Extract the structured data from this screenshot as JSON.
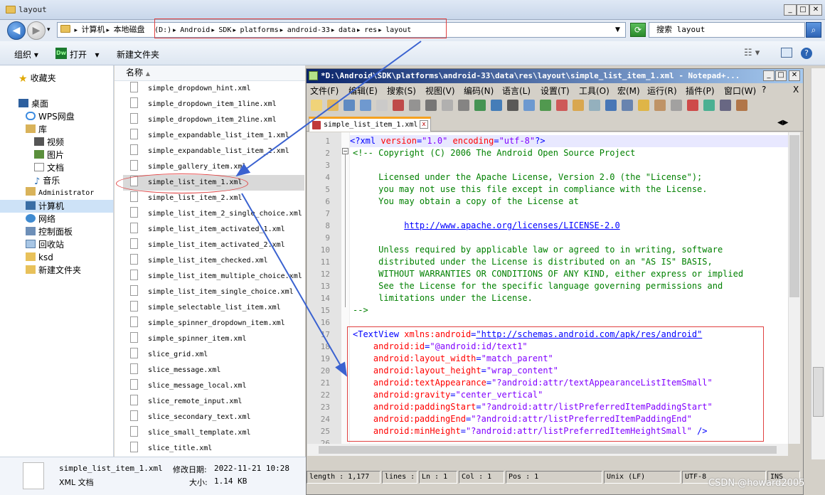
{
  "explorer": {
    "title": "layout",
    "breadcrumbs_left": [
      "计算机",
      "本地磁盘"
    ],
    "breadcrumbs_right": [
      "(D:)",
      "Android",
      "SDK",
      "platforms",
      "android-33",
      "data",
      "res",
      "layout"
    ],
    "search_placeholder": "搜索 layout",
    "toolbar": {
      "organize": "组织",
      "open": "打开",
      "new_folder": "新建文件夹"
    },
    "column_name": "名称",
    "nav": {
      "favorites": "收藏夹",
      "desktop": "桌面",
      "wps": "WPS网盘",
      "library": "库",
      "videos": "视频",
      "pictures": "图片",
      "documents": "文档",
      "music": "音乐",
      "admin": "Administrator",
      "computer": "计算机",
      "network": "网络",
      "control_panel": "控制面板",
      "recycle": "回收站",
      "ksd": "ksd",
      "new_folder": "新建文件夹"
    },
    "files": [
      "simple_dropdown_hint.xml",
      "simple_dropdown_item_1line.xml",
      "simple_dropdown_item_2line.xml",
      "simple_expandable_list_item_1.xml",
      "simple_expandable_list_item_2.xml",
      "simple_gallery_item.xml",
      "simple_list_item_1.xml",
      "simple_list_item_2.xml",
      "simple_list_item_2_single_choice.xml",
      "simple_list_item_activated_1.xml",
      "simple_list_item_activated_2.xml",
      "simple_list_item_checked.xml",
      "simple_list_item_multiple_choice.xml",
      "simple_list_item_single_choice.xml",
      "simple_selectable_list_item.xml",
      "simple_spinner_dropdown_item.xml",
      "simple_spinner_item.xml",
      "slice_grid.xml",
      "slice_message.xml",
      "slice_message_local.xml",
      "slice_remote_input.xml",
      "slice_secondary_text.xml",
      "slice_small_template.xml",
      "slice_title.xml"
    ],
    "selected_index": 6,
    "details": {
      "name": "simple_list_item_1.xml",
      "modified_label": "修改日期:",
      "modified": "2022-11-21 10:28",
      "type": "XML 文档",
      "size_label": "大小:",
      "size": "1.14 KB"
    }
  },
  "npp": {
    "title": "*D:\\Android\\SDK\\platforms\\android-33\\data\\res\\layout\\simple_list_item_1.xml - Notepad+...",
    "menu": [
      "文件(F)",
      "编辑(E)",
      "搜索(S)",
      "视图(V)",
      "编码(N)",
      "语言(L)",
      "设置(T)",
      "工具(O)",
      "宏(M)",
      "运行(R)",
      "插件(P)",
      "窗口(W)",
      "?"
    ],
    "close_x": "X",
    "tab": "simple_list_item_1.xml",
    "status": {
      "length": "length : 1,177",
      "lines": "lines :",
      "ln": "Ln : 1",
      "col": "Col : 1",
      "pos": "Pos : 1",
      "eol": "Unix (LF)",
      "enc": "UTF-8",
      "ins": "INS"
    }
  },
  "code_lines": [
    [
      [
        "tag",
        "<?xml "
      ],
      [
        "attr",
        "version"
      ],
      [
        "tag",
        "="
      ],
      [
        "val",
        "\"1.0\""
      ],
      [
        "tag",
        " "
      ],
      [
        "attr",
        "encoding"
      ],
      [
        "tag",
        "="
      ],
      [
        "val",
        "\"utf-8\""
      ],
      [
        "tag",
        "?>"
      ]
    ],
    [
      [
        "cmt",
        "<!-- Copyright (C) 2006 The Android Open Source Project"
      ]
    ],
    [],
    [
      [
        "cmt",
        "     Licensed under the Apache License, Version 2.0 (the \"License\");"
      ]
    ],
    [
      [
        "cmt",
        "     you may not use this file except in compliance with the License."
      ]
    ],
    [
      [
        "cmt",
        "     You may obtain a copy of the License at"
      ]
    ],
    [],
    [
      [
        "cmt",
        "          "
      ],
      [
        "lnk",
        "http://www.apache.org/licenses/LICENSE-2.0"
      ]
    ],
    [],
    [
      [
        "cmt",
        "     Unless required by applicable law or agreed to in writing, software"
      ]
    ],
    [
      [
        "cmt",
        "     distributed under the License is distributed on an \"AS IS\" BASIS,"
      ]
    ],
    [
      [
        "cmt",
        "     WITHOUT WARRANTIES OR CONDITIONS OF ANY KIND, either express or implied"
      ]
    ],
    [
      [
        "cmt",
        "     See the License for the specific language governing permissions and"
      ]
    ],
    [
      [
        "cmt",
        "     limitations under the License."
      ]
    ],
    [
      [
        "cmt",
        "-->"
      ]
    ],
    [],
    [
      [
        "tag",
        "<TextView "
      ],
      [
        "attr",
        "xmlns:android"
      ],
      [
        "tag",
        "="
      ],
      [
        "lnk",
        "\"http://schemas.android.com/apk/res/android\""
      ]
    ],
    [
      [
        "attr",
        "    android:id"
      ],
      [
        "tag",
        "="
      ],
      [
        "val",
        "\"@android:id/text1\""
      ]
    ],
    [
      [
        "attr",
        "    android:layout_width"
      ],
      [
        "tag",
        "="
      ],
      [
        "val",
        "\"match_parent\""
      ]
    ],
    [
      [
        "attr",
        "    android:layout_height"
      ],
      [
        "tag",
        "="
      ],
      [
        "val",
        "\"wrap_content\""
      ]
    ],
    [
      [
        "attr",
        "    android:textAppearance"
      ],
      [
        "tag",
        "="
      ],
      [
        "val",
        "\"?android:attr/textAppearanceListItemSmall\""
      ]
    ],
    [
      [
        "attr",
        "    android:gravity"
      ],
      [
        "tag",
        "="
      ],
      [
        "val",
        "\"center_vertical\""
      ]
    ],
    [
      [
        "attr",
        "    android:paddingStart"
      ],
      [
        "tag",
        "="
      ],
      [
        "val",
        "\"?android:attr/listPreferredItemPaddingStart\""
      ]
    ],
    [
      [
        "attr",
        "    android:paddingEnd"
      ],
      [
        "tag",
        "="
      ],
      [
        "val",
        "\"?android:attr/listPreferredItemPaddingEnd\""
      ]
    ],
    [
      [
        "attr",
        "    android:minHeight"
      ],
      [
        "tag",
        "="
      ],
      [
        "val",
        "\"?android:attr/listPreferredItemHeightSmall\""
      ],
      [
        "tag",
        " />"
      ]
    ],
    []
  ],
  "watermark": "CSDN @howard2005"
}
